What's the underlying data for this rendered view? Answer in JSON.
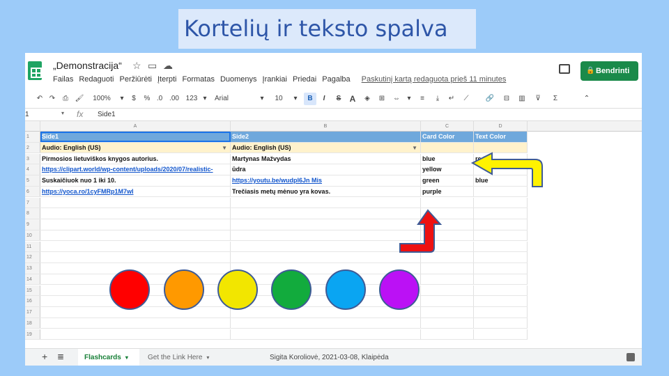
{
  "slide": {
    "title": "Kortelių ir teksto spalva",
    "footer": "Sigita Koroliovė, 2021-03-08, Klaipėda"
  },
  "app": {
    "doc_title": "„Demonstracija“",
    "menu": [
      "Failas",
      "Redaguoti",
      "Peržiūrėti",
      "Įterpti",
      "Formatas",
      "Duomenys",
      "Įrankiai",
      "Priedai",
      "Pagalba"
    ],
    "last_edit": "Paskutinį kartą redaguota prieš 11 minutes",
    "share_label": "Bendrinti",
    "toolbar": {
      "zoom": "100%",
      "currency": "$",
      "percent": "%",
      "decimal_less": ".0",
      "decimal_more": ".00",
      "number_format": "123",
      "font": "Arial",
      "font_size": "10",
      "bold": "B",
      "italic": "I",
      "strike": "S",
      "text_color": "A"
    },
    "name_box": "1",
    "fx": "fx",
    "formula": "Side1",
    "columns": [
      "A",
      "B",
      "C",
      "D"
    ],
    "rows": [
      {
        "num": "1",
        "a": "Side1",
        "b": "Side2",
        "c": "Card Color",
        "d": "Text Color"
      },
      {
        "num": "2",
        "a": "Audio: English (US)",
        "b": "Audio: English (US)",
        "c": "",
        "d": ""
      },
      {
        "num": "3",
        "a": "Pirmosios lietuviškos knygos autorius.",
        "b": "Martynas Mažvydas",
        "c": "blue",
        "d": "red"
      },
      {
        "num": "4",
        "a": "https://clipart.world/wp-content/uploads/2020/07/realistic-",
        "b": "ūdra",
        "c": "yellow",
        "d": ""
      },
      {
        "num": "5",
        "a": "Suskaičiuok nuo 1 iki 10.",
        "b": "https://youtu.be/wudpl6Jn Mis",
        "c": "green",
        "d": "blue"
      },
      {
        "num": "6",
        "a": "https://yoca.ro/1cyFMRp1M7wI",
        "b": "Trečiasis metų mėnuo yra kovas.",
        "c": "purple",
        "d": ""
      },
      {
        "num": "7",
        "a": "",
        "b": "",
        "c": "",
        "d": ""
      },
      {
        "num": "8",
        "a": "",
        "b": "",
        "c": "",
        "d": ""
      },
      {
        "num": "9",
        "a": "",
        "b": "",
        "c": "",
        "d": ""
      },
      {
        "num": "10",
        "a": "",
        "b": "",
        "c": "",
        "d": ""
      },
      {
        "num": "11",
        "a": "",
        "b": "",
        "c": "",
        "d": ""
      },
      {
        "num": "12",
        "a": "",
        "b": "",
        "c": "",
        "d": ""
      },
      {
        "num": "13",
        "a": "",
        "b": "",
        "c": "",
        "d": ""
      },
      {
        "num": "14",
        "a": "",
        "b": "",
        "c": "",
        "d": ""
      },
      {
        "num": "15",
        "a": "",
        "b": "",
        "c": "",
        "d": ""
      },
      {
        "num": "16",
        "a": "",
        "b": "",
        "c": "",
        "d": ""
      },
      {
        "num": "17",
        "a": "",
        "b": "",
        "c": "",
        "d": ""
      },
      {
        "num": "18",
        "a": "",
        "b": "",
        "c": "",
        "d": ""
      },
      {
        "num": "19",
        "a": "",
        "b": "",
        "c": "",
        "d": ""
      }
    ],
    "tabs": {
      "active": "Flashcards",
      "other": "Get the Link Here"
    }
  },
  "colors": {
    "header_row": "#6fa8dc",
    "audio_row": "#fff2cc",
    "circles": [
      "#ff0000",
      "#ff9900",
      "#f2e600",
      "#12ab3d",
      "#0aa5f2",
      "#bb11f5"
    ]
  }
}
